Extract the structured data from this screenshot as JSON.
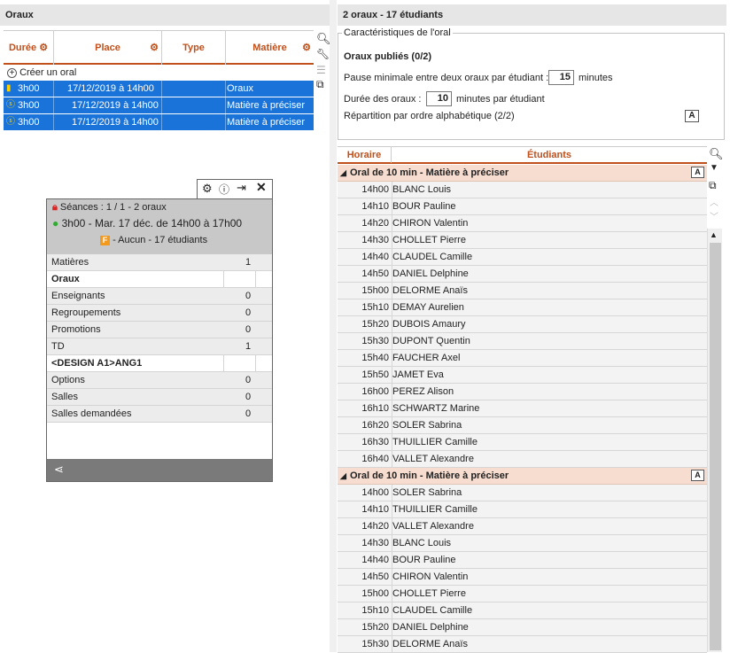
{
  "left_panel": {
    "title": "Oraux",
    "columns": [
      "Durée",
      "Place",
      "Type",
      "Matière"
    ],
    "create_label": "Créer un oral",
    "rows": [
      {
        "duree": "3h00",
        "place": "17/12/2019  à 14h00",
        "type": "",
        "matiere": "Oraux"
      },
      {
        "duree": "3h00",
        "place": "17/12/2019  à 14h00",
        "type": "",
        "matiere": "Matière à préciser"
      },
      {
        "duree": "3h00",
        "place": "17/12/2019  à 14h00",
        "type": "",
        "matiere": "Matière à préciser"
      }
    ]
  },
  "tooltip": {
    "seances": "Séances : 1 / 1 - 2 oraux",
    "time": "3h00 - Mar. 17 déc. de 14h00 à 17h00",
    "badge": "F",
    "aucun": "- Aucun - 17 étudiants",
    "rows": [
      {
        "label": "Matières",
        "count": "1"
      },
      {
        "label": "Oraux",
        "count": ""
      },
      {
        "label": "Enseignants",
        "count": "0"
      },
      {
        "label": "Regroupements",
        "count": "0"
      },
      {
        "label": "Promotions",
        "count": "0"
      },
      {
        "label": "TD",
        "count": "1"
      },
      {
        "label": "<DESIGN A1>ANG1",
        "count": ""
      },
      {
        "label": "Options",
        "count": "0"
      },
      {
        "label": "Salles",
        "count": "0"
      },
      {
        "label": "Salles demandées",
        "count": "0"
      }
    ]
  },
  "right_panel": {
    "title": "2 oraux - 17 étudiants",
    "fieldset_legend": "Caractéristiques de l'oral",
    "publies": "Oraux publiés (0/2)",
    "pause_label": "Pause minimale entre deux oraux par étudiant :",
    "pause_value": "15",
    "pause_unit": "minutes",
    "duree_label": "Durée des oraux :",
    "duree_value": "10",
    "duree_unit": "minutes par étudiant",
    "repartition": "Répartition par ordre alphabétique (2/2)",
    "col_horaire": "Horaire",
    "col_etudiants": "Étudiants",
    "groups": [
      {
        "title": "Oral de 10 min - Matière à préciser",
        "rows": [
          {
            "t": "14h00",
            "n": "BLANC Louis"
          },
          {
            "t": "14h10",
            "n": "BOUR Pauline"
          },
          {
            "t": "14h20",
            "n": "CHIRON Valentin"
          },
          {
            "t": "14h30",
            "n": "CHOLLET Pierre"
          },
          {
            "t": "14h40",
            "n": "CLAUDEL Camille"
          },
          {
            "t": "14h50",
            "n": "DANIEL Delphine"
          },
          {
            "t": "15h00",
            "n": "DELORME Anaïs"
          },
          {
            "t": "15h10",
            "n": "DEMAY Aurelien"
          },
          {
            "t": "15h20",
            "n": "DUBOIS Amaury"
          },
          {
            "t": "15h30",
            "n": "DUPONT Quentin"
          },
          {
            "t": "15h40",
            "n": "FAUCHER Axel"
          },
          {
            "t": "15h50",
            "n": "JAMET Eva"
          },
          {
            "t": "16h00",
            "n": "PEREZ Alison"
          },
          {
            "t": "16h10",
            "n": "SCHWARTZ Marine"
          },
          {
            "t": "16h20",
            "n": "SOLER Sabrina"
          },
          {
            "t": "16h30",
            "n": "THUILLIER Camille"
          },
          {
            "t": "16h40",
            "n": "VALLET Alexandre"
          }
        ]
      },
      {
        "title": "Oral de 10 min - Matière à préciser",
        "rows": [
          {
            "t": "14h00",
            "n": "SOLER Sabrina"
          },
          {
            "t": "14h10",
            "n": "THUILLIER Camille"
          },
          {
            "t": "14h20",
            "n": "VALLET Alexandre"
          },
          {
            "t": "14h30",
            "n": "BLANC Louis"
          },
          {
            "t": "14h40",
            "n": "BOUR Pauline"
          },
          {
            "t": "14h50",
            "n": "CHIRON Valentin"
          },
          {
            "t": "15h00",
            "n": "CHOLLET Pierre"
          },
          {
            "t": "15h10",
            "n": "CLAUDEL Camille"
          },
          {
            "t": "15h20",
            "n": "DANIEL Delphine"
          },
          {
            "t": "15h30",
            "n": "DELORME Anaïs"
          }
        ]
      }
    ]
  },
  "colors": {
    "accent": "#c0501c",
    "selection": "#1a73d9",
    "group_bg": "#f6ddd0"
  }
}
